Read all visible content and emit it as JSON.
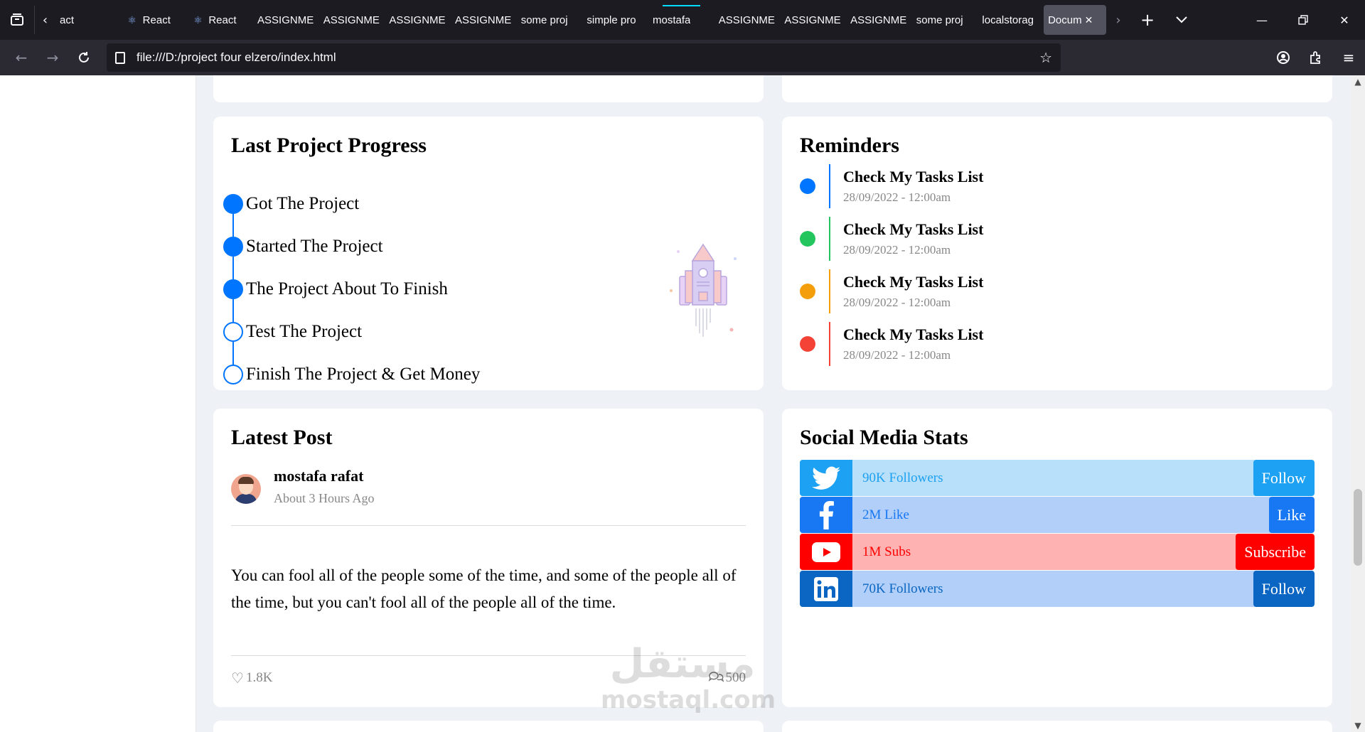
{
  "browser": {
    "tabs": [
      {
        "label": "act",
        "icon": "back-chevron"
      },
      {
        "label": "React",
        "icon": "react-icon"
      },
      {
        "label": "React",
        "icon": "react-icon"
      },
      {
        "label": "ASSIGNME",
        "icon": ""
      },
      {
        "label": "ASSIGNME",
        "icon": ""
      },
      {
        "label": "ASSIGNME",
        "icon": ""
      },
      {
        "label": "ASSIGNME",
        "icon": ""
      },
      {
        "label": "some proj",
        "icon": ""
      },
      {
        "label": "simple pro",
        "icon": ""
      },
      {
        "label": "mostafa",
        "icon": ""
      },
      {
        "label": "ASSIGNME",
        "icon": ""
      },
      {
        "label": "ASSIGNME",
        "icon": ""
      },
      {
        "label": "ASSIGNME",
        "icon": ""
      },
      {
        "label": "some proj",
        "icon": ""
      },
      {
        "label": "localstorag",
        "icon": ""
      },
      {
        "label": "Docum",
        "icon": "",
        "active": true
      }
    ],
    "url": "file:///D:/project four elzero/index.html"
  },
  "progress": {
    "title": "Last Project Progress",
    "items": [
      {
        "label": "Got The Project",
        "done": true
      },
      {
        "label": "Started The Project",
        "done": true
      },
      {
        "label": "The Project About To Finish",
        "done": true
      },
      {
        "label": "Test The Project",
        "done": false
      },
      {
        "label": "Finish The Project & Get Money",
        "done": false
      }
    ]
  },
  "reminders": {
    "title": "Reminders",
    "items": [
      {
        "title": "Check My Tasks List",
        "date": "28/09/2022 - 12:00am",
        "color": "#0075ff"
      },
      {
        "title": "Check My Tasks List",
        "date": "28/09/2022 - 12:00am",
        "color": "#22c55e"
      },
      {
        "title": "Check My Tasks List",
        "date": "28/09/2022 - 12:00am",
        "color": "#f59e0b"
      },
      {
        "title": "Check My Tasks List",
        "date": "28/09/2022 - 12:00am",
        "color": "#f44336"
      }
    ]
  },
  "post": {
    "title": "Latest Post",
    "author": "mostafa rafat",
    "time": "About 3 Hours Ago",
    "text": "You can fool all of the people some of the time, and some of the people all of the time, but you can't fool all of the people all of the time.",
    "likes": "1.8K",
    "comments": "500"
  },
  "social": {
    "title": "Social Media Stats",
    "items": [
      {
        "network": "twitter",
        "icon": "twitter-icon",
        "text": "90K Followers",
        "button": "Follow",
        "main": "#1da1f2",
        "light": "#b9e0fb",
        "textColor": "#1da1f2"
      },
      {
        "network": "facebook",
        "icon": "facebook-icon",
        "text": "2M Like",
        "button": "Like",
        "main": "#1877f2",
        "light": "#b1cff9",
        "textColor": "#1877f2"
      },
      {
        "network": "youtube",
        "icon": "youtube-icon",
        "text": "1M Subs",
        "button": "Subscribe",
        "main": "#ff0000",
        "light": "#ffb2b2",
        "textColor": "#ff0000"
      },
      {
        "network": "linkedin",
        "icon": "linkedin-icon",
        "text": "70K Followers",
        "button": "Follow",
        "main": "#0a66c2",
        "light": "#b1cff9",
        "textColor": "#0a66c2"
      }
    ]
  },
  "watermark": {
    "arabic": "مستقل",
    "latin": "mostaql.com"
  }
}
